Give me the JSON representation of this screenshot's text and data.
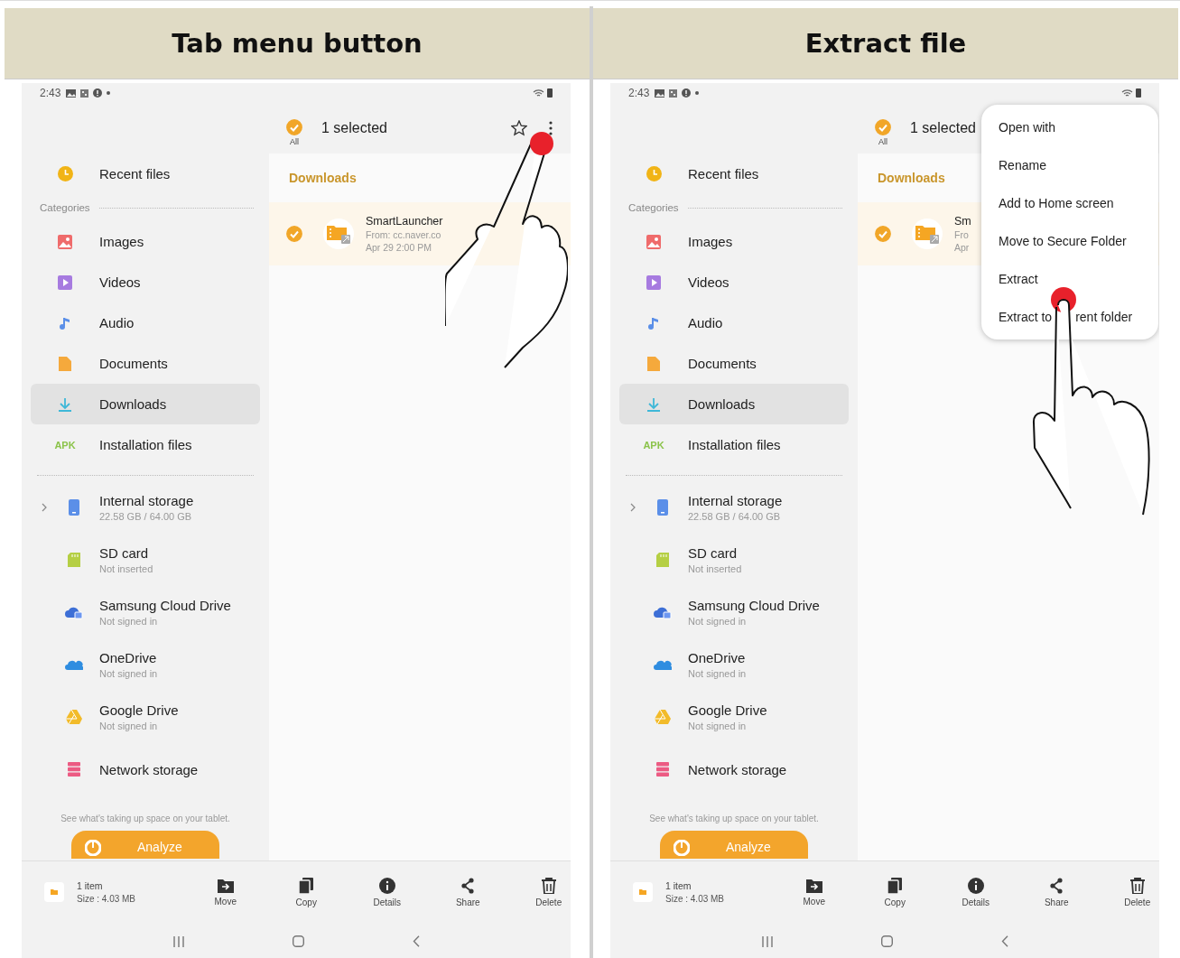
{
  "panels": [
    {
      "heading": "Tab menu button",
      "status_bar": {
        "time": "2:43"
      },
      "sidebar": {
        "recent": {
          "label": "Recent files",
          "selected": false
        },
        "categories_label": "Categories",
        "categories": [
          {
            "label": "Images",
            "kind": "images",
            "selected": false
          },
          {
            "label": "Videos",
            "kind": "videos",
            "selected": false
          },
          {
            "label": "Audio",
            "kind": "audio",
            "selected": false
          },
          {
            "label": "Documents",
            "kind": "documents",
            "selected": false
          },
          {
            "label": "Downloads",
            "kind": "downloads",
            "selected": true
          },
          {
            "label": "Installation files",
            "kind": "apk",
            "badge": "APK",
            "selected": false
          }
        ],
        "storage": [
          {
            "label": "Internal storage",
            "detail": "22.58 GB / 64.00 GB",
            "kind": "phone",
            "chevron": true
          },
          {
            "label": "SD card",
            "detail": "Not inserted",
            "kind": "sdcard",
            "chevron": false
          },
          {
            "label": "Samsung Cloud Drive",
            "detail": "Not signed in",
            "kind": "samsungcloud",
            "chevron": false
          },
          {
            "label": "OneDrive",
            "detail": "Not signed in",
            "kind": "onedrive",
            "chevron": false
          },
          {
            "label": "Google Drive",
            "detail": "Not signed in",
            "kind": "gdrive",
            "chevron": false
          },
          {
            "label": "Network storage",
            "kind": "network",
            "chevron": false
          }
        ],
        "note": "See what's taking up space on your tablet.",
        "analyze_button": "Analyze"
      },
      "header": {
        "all_label": "All",
        "all_checked": true,
        "title": "1 selected"
      },
      "section_title": "Downloads",
      "files": [
        {
          "name": "SmartLauncher",
          "source": "From: cc.naver.co",
          "date": "Apr 29 2:00 PM",
          "checked": true
        }
      ],
      "bottom_bar": {
        "count": "1 item",
        "size": "Size : 4.03 MB",
        "actions": [
          {
            "label": "Move",
            "kind": "move"
          },
          {
            "label": "Copy",
            "kind": "copy"
          },
          {
            "label": "Details",
            "kind": "details"
          },
          {
            "label": "Share",
            "kind": "share"
          },
          {
            "label": "Delete",
            "kind": "delete"
          }
        ]
      }
    },
    {
      "heading": "Extract file",
      "status_bar": {
        "time": "2:43"
      },
      "sidebar": {
        "recent": {
          "label": "Recent files",
          "selected": false
        },
        "categories_label": "Categories",
        "categories": [
          {
            "label": "Images",
            "kind": "images",
            "selected": false
          },
          {
            "label": "Videos",
            "kind": "videos",
            "selected": false
          },
          {
            "label": "Audio",
            "kind": "audio",
            "selected": false
          },
          {
            "label": "Documents",
            "kind": "documents",
            "selected": false
          },
          {
            "label": "Downloads",
            "kind": "downloads",
            "selected": true
          },
          {
            "label": "Installation files",
            "kind": "apk",
            "badge": "APK",
            "selected": false
          }
        ],
        "storage": [
          {
            "label": "Internal storage",
            "detail": "22.58 GB / 64.00 GB",
            "kind": "phone",
            "chevron": true
          },
          {
            "label": "SD card",
            "detail": "Not inserted",
            "kind": "sdcard",
            "chevron": false
          },
          {
            "label": "Samsung Cloud Drive",
            "detail": "Not signed in",
            "kind": "samsungcloud",
            "chevron": false
          },
          {
            "label": "OneDrive",
            "detail": "Not signed in",
            "kind": "onedrive",
            "chevron": false
          },
          {
            "label": "Google Drive",
            "detail": "Not signed in",
            "kind": "gdrive",
            "chevron": false
          },
          {
            "label": "Network storage",
            "kind": "network",
            "chevron": false
          }
        ],
        "note": "See what's taking up space on your tablet.",
        "analyze_button": "Analyze"
      },
      "header": {
        "all_label": "All",
        "all_checked": true,
        "title": "1 selected"
      },
      "section_title": "Downloads",
      "files": [
        {
          "name": "Sm",
          "source": "Fro",
          "date": "Apr",
          "checked": true
        }
      ],
      "menu": {
        "items": [
          {
            "label": "Open with"
          },
          {
            "label": "Rename"
          },
          {
            "label": "Add to Home screen"
          },
          {
            "label": "Move to Secure Folder"
          },
          {
            "label": "Extract"
          },
          {
            "label": "Extract to",
            "label_rest": "rent folder"
          }
        ]
      },
      "bottom_bar": {
        "count": "1 item",
        "size": "Size : 4.03 MB",
        "actions": [
          {
            "label": "Move",
            "kind": "move"
          },
          {
            "label": "Copy",
            "kind": "copy"
          },
          {
            "label": "Details",
            "kind": "details"
          },
          {
            "label": "Share",
            "kind": "share"
          },
          {
            "label": "Delete",
            "kind": "delete"
          }
        ]
      }
    }
  ]
}
